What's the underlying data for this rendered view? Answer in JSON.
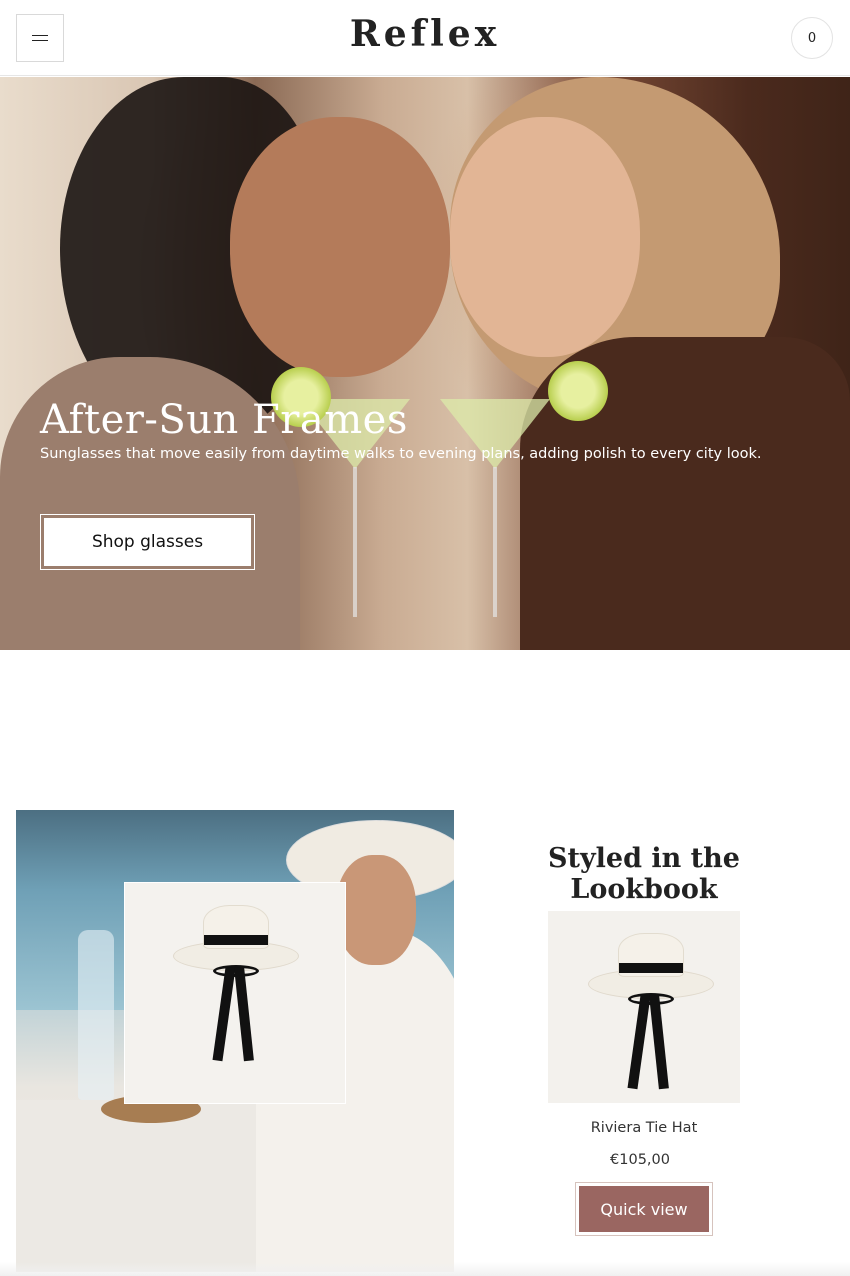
{
  "header": {
    "logo": "Reflex",
    "menu_icon": "hamburger-icon",
    "cart_count": "0"
  },
  "hero": {
    "title": "After-Sun Frames",
    "subtitle": "Sunglasses that move easily from daytime walks to evening plans, adding polish to every city look.",
    "button_label": "Shop glasses"
  },
  "lookbook": {
    "title": "Styled in the Lookbook",
    "product": {
      "name": "Riviera Tie Hat",
      "price": "€105,00",
      "button_label": "Quick view"
    }
  },
  "colors": {
    "accent_button": "#9a6661",
    "text": "#222222"
  }
}
